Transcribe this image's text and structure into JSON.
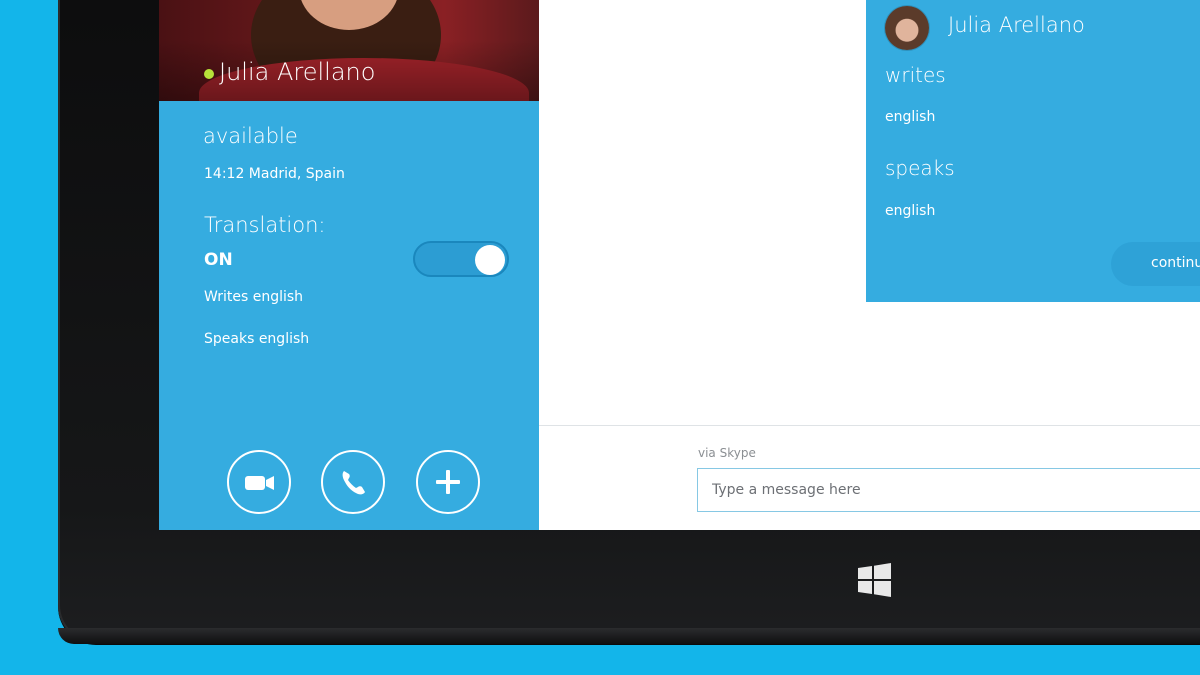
{
  "contact": {
    "name": "Julia Arellano",
    "status": "available",
    "local_time": "14:12 Madrid, Spain",
    "status_color": "#b7e23a"
  },
  "translation": {
    "title": "Translation:",
    "state": "ON",
    "writes": "Writes english",
    "speaks": "Speaks english"
  },
  "actions": [
    {
      "icon": "video-camera-icon"
    },
    {
      "icon": "phone-icon"
    },
    {
      "icon": "plus-icon"
    }
  ],
  "card": {
    "name": "Julia Arellano",
    "writes_label": "writes",
    "writes_value": "english",
    "speaks_label": "speaks",
    "speaks_value": "english",
    "continue_label": "continue"
  },
  "composer": {
    "via": "via Skype",
    "placeholder": "Type a message here"
  },
  "colors": {
    "panel": "#35ace0",
    "background": "#13b5ea",
    "device": "#111213"
  }
}
